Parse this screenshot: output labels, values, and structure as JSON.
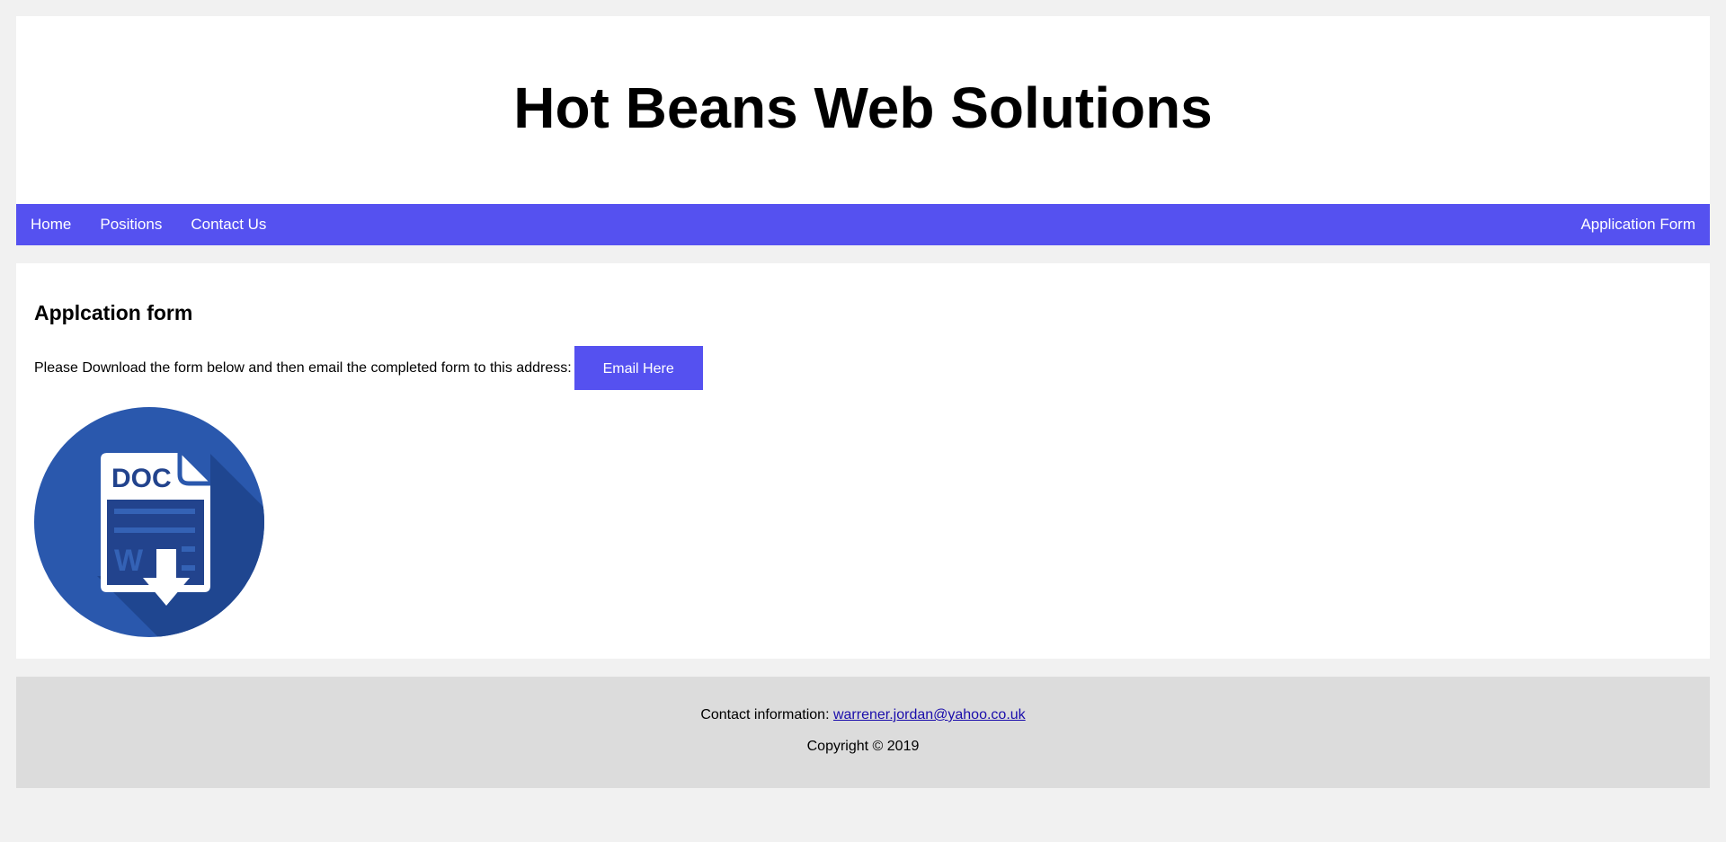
{
  "header": {
    "title": "Hot Beans Web Solutions"
  },
  "nav": {
    "items": [
      {
        "label": "Home"
      },
      {
        "label": "Positions"
      },
      {
        "label": "Contact Us"
      }
    ],
    "right_item": {
      "label": "Application Form"
    },
    "background_color": "#5551f0"
  },
  "main": {
    "heading": "Applcation form",
    "intro_text": "Please Download the form below and then email the completed form to this address:",
    "email_button_label": "Email Here",
    "download_icon": {
      "name": "doc-download-icon",
      "label": "DOC",
      "secondary_label": "W"
    }
  },
  "footer": {
    "contact_prefix": "Contact information:",
    "contact_email": "warrener.jordan@yahoo.co.uk",
    "copyright": "Copyright © 2019"
  },
  "colors": {
    "page_background": "#f1f1f1",
    "accent": "#5551f0",
    "footer_background": "#dcdcdc",
    "icon_blue": "#2a58ad",
    "icon_shadow": "#1f4690"
  }
}
